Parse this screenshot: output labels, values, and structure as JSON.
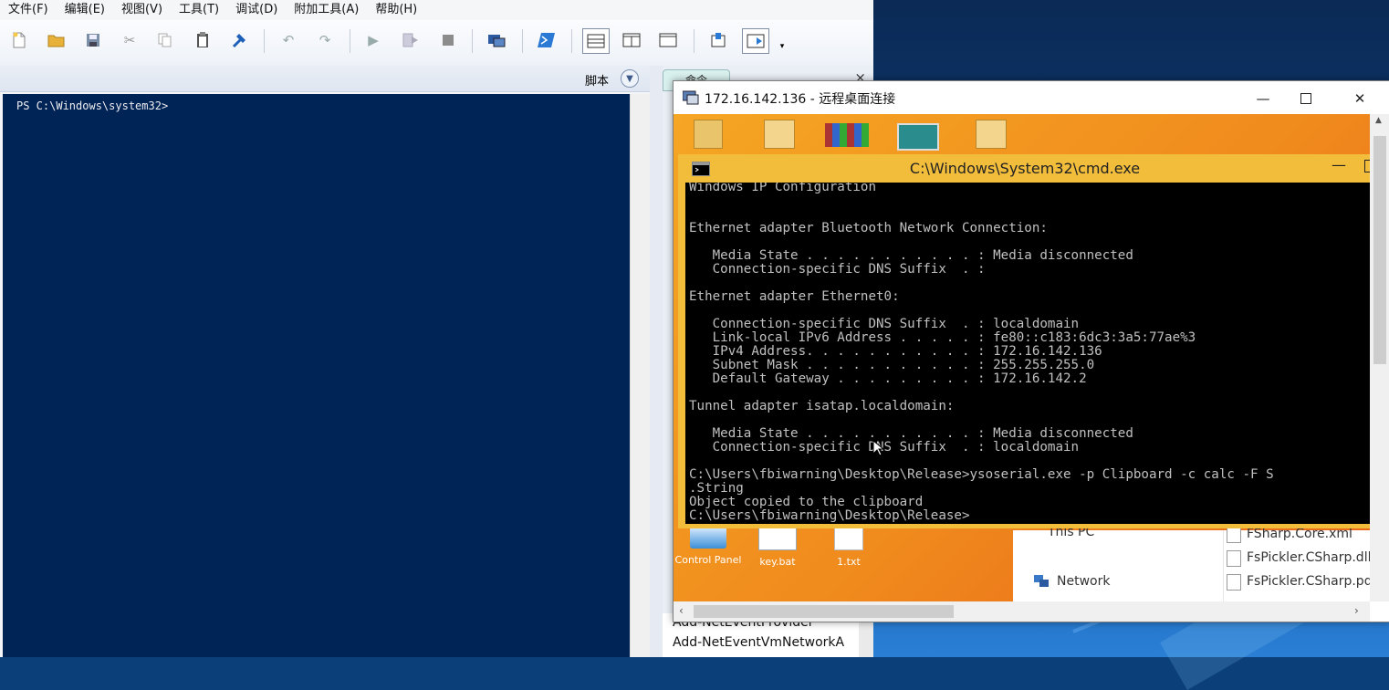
{
  "ise": {
    "menu": [
      "文件(F)",
      "编辑(E)",
      "视图(V)",
      "工具(T)",
      "调试(D)",
      "附加工具(A)",
      "帮助(H)"
    ],
    "script_pane_label": "脚本",
    "console_prompt": "PS C:\\Windows\\system32>",
    "commands_tab_label": "命令",
    "commands_list": [
      "Add-NetEventProvider",
      "Add-NetEventVmNetworkA"
    ]
  },
  "rdp": {
    "title": "172.16.142.136 - 远程桌面连接",
    "desktop_icons": [
      "Control Panel",
      "key.bat",
      "1.txt"
    ],
    "explorer": {
      "nav": [
        "This PC",
        "Network"
      ],
      "files": [
        "FSharp.Core.xml",
        "FsPickler.CSharp.dll",
        "FsPickler.CSharp.pdb"
      ]
    },
    "cmd": {
      "title": "C:\\Windows\\System32\\cmd.exe",
      "lines": [
        "Windows IP Configuration",
        "",
        "",
        "Ethernet adapter Bluetooth Network Connection:",
        "",
        "   Media State . . . . . . . . . . . : Media disconnected",
        "   Connection-specific DNS Suffix  . :",
        "",
        "Ethernet adapter Ethernet0:",
        "",
        "   Connection-specific DNS Suffix  . : localdomain",
        "   Link-local IPv6 Address . . . . . : fe80::c183:6dc3:3a5:77ae%3",
        "   IPv4 Address. . . . . . . . . . . : 172.16.142.136",
        "   Subnet Mask . . . . . . . . . . . : 255.255.255.0",
        "   Default Gateway . . . . . . . . . : 172.16.142.2",
        "",
        "Tunnel adapter isatap.localdomain:",
        "",
        "   Media State . . . . . . . . . . . : Media disconnected",
        "   Connection-specific DNS Suffix  . : localdomain",
        "",
        "C:\\Users\\fbiwarning\\Desktop\\Release>ysoserial.exe -p Clipboard -c calc -F S",
        ".String",
        "Object copied to the clipboard",
        "C:\\Users\\fbiwarning\\Desktop\\Release>"
      ]
    }
  },
  "colors": {
    "console_bg": "#012456",
    "cmd_titlebar": "#f3bd3c",
    "remote_desktop_orange": "#f08a1d"
  }
}
